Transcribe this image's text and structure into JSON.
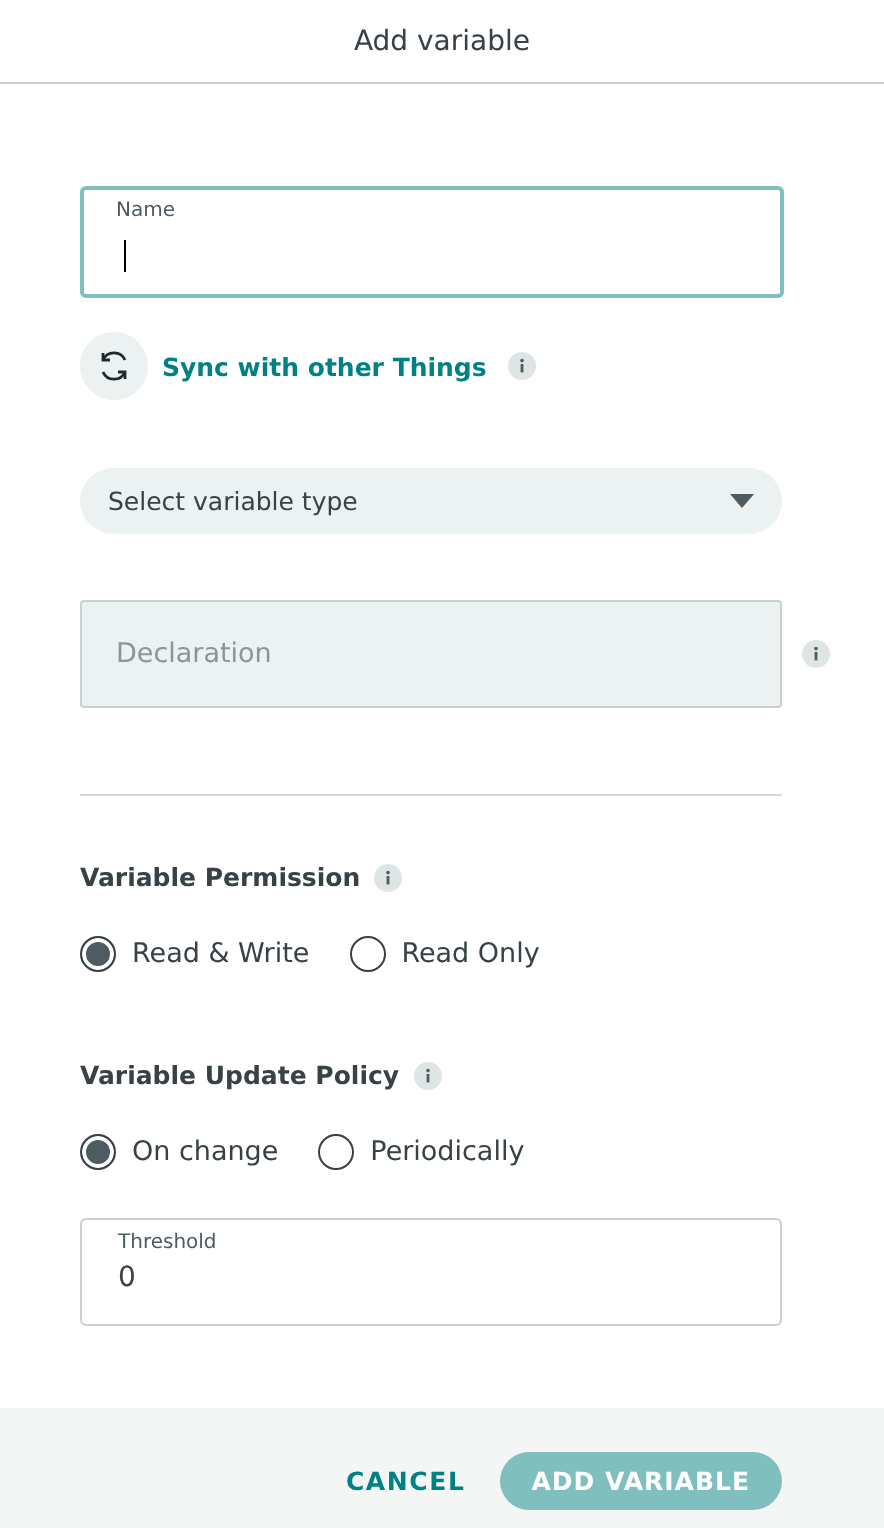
{
  "dialog": {
    "title": "Add variable"
  },
  "name_field": {
    "label": "Name",
    "focused": true
  },
  "sync": {
    "label": "Sync with other Things"
  },
  "type_select": {
    "placeholder": "Select variable type"
  },
  "declaration": {
    "placeholder": "Declaration",
    "disabled": true
  },
  "permission": {
    "heading": "Variable Permission",
    "options": [
      {
        "label": "Read & Write",
        "selected": true
      },
      {
        "label": "Read Only",
        "selected": false
      }
    ]
  },
  "update_policy": {
    "heading": "Variable Update Policy",
    "options": [
      {
        "label": "On change",
        "selected": true
      },
      {
        "label": "Periodically",
        "selected": false
      }
    ]
  },
  "threshold": {
    "label": "Threshold",
    "value": "0"
  },
  "buttons": [
    {
      "label": "CANCEL",
      "kind": "text"
    },
    {
      "label": "ADD VARIABLE",
      "kind": "primary",
      "disabled": true
    }
  ]
}
